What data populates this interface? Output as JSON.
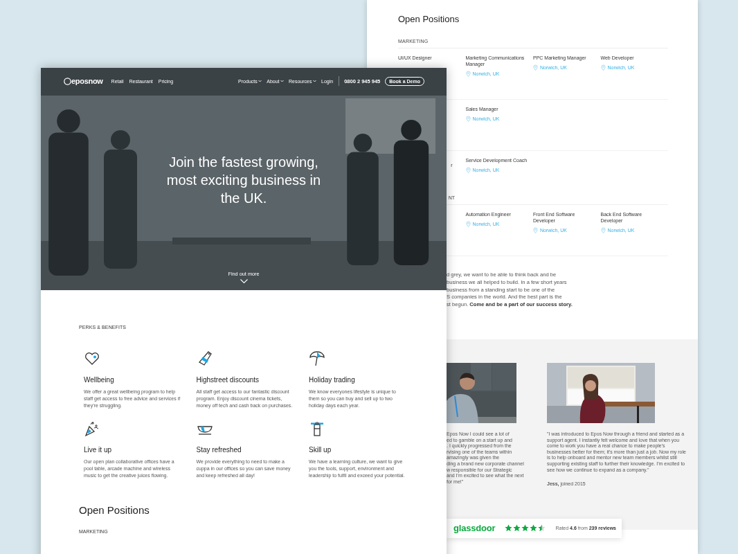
{
  "background_page": {
    "title": "Open Positions",
    "sections": [
      {
        "label": "MARKETING",
        "covered": false,
        "rows": [
          {
            "cells": [
              {
                "kind": "job",
                "title": "UI/UX Designer"
              },
              {
                "kind": "job",
                "title": "Marketing Communications Manager",
                "location": "Norwich, UK"
              },
              {
                "kind": "job",
                "title": "PPC Marketing Manager",
                "location": "Norwich, UK"
              },
              {
                "kind": "job",
                "title": "Web Developer",
                "location": "Norwich, UK"
              }
            ]
          },
          {
            "cells": [
              {
                "kind": "covered"
              },
              {
                "kind": "job",
                "title": "Sales Manager",
                "location": "Norwich, UK"
              }
            ]
          },
          {
            "cells": [
              {
                "kind": "fragment",
                "title": "r"
              },
              {
                "kind": "job",
                "title": "Service Development Coach",
                "location": "Norwich, UK"
              }
            ]
          }
        ]
      },
      {
        "label": "NT",
        "covered": true,
        "rows": [
          {
            "cells": [
              {
                "kind": "covered"
              },
              {
                "kind": "job",
                "title": "Automation Engineer",
                "location": "Norwich, UK"
              },
              {
                "kind": "job",
                "title": "Front End Software Developer",
                "location": "Norwich, UK"
              },
              {
                "kind": "job",
                "title": "Back End Software Developer",
                "location": "Norwich, UK"
              }
            ]
          }
        ]
      }
    ],
    "story": {
      "lines": [
        "d grey, we want to be able to think back and be",
        "business we all helped to build. In a few short years",
        "business from a standing start to be one of the",
        "S companies in the world. And the best part is the",
        "st begun. **Come and be a part of our success story.**"
      ]
    },
    "testimonials": [
      {
        "quote_lines": [
          "Epos Now I could see a lot of",
          "ed to gamble on a start up and",
          ". I quickly progressed from the",
          "rvising one of the teams within",
          "amazingly was given the",
          "ding a brand new corporate channel",
          "w responsible for our Strategic",
          "and I'm excited to see what the next",
          "for me!\""
        ]
      },
      {
        "quote": "\"I was introduced to Epos Now through a friend and started as a support agent. I instantly felt welcome and love that when you come to work you have a real chance to make people's businesses better for them; it's more than just a job. Now my role is to help onboard and mentor new team members whilst still supporting existing staff to further their knowledge. I'm excited to see how we continue to expand as a company.\"",
        "author": "**Jess,** joined 2015"
      }
    ],
    "glassdoor": {
      "logo": "glassdoor",
      "stars": 4.5,
      "rating": "Rated **4.6** from **239 reviews**"
    }
  },
  "front_page": {
    "nav": {
      "logo": "eposnow",
      "links": [
        "Retail",
        "Restaurant",
        "Pricing"
      ],
      "menu": [
        {
          "label": "Products",
          "dropdown": true
        },
        {
          "label": "About",
          "dropdown": true
        },
        {
          "label": "Resources",
          "dropdown": true
        },
        {
          "label": "Login",
          "dropdown": false
        }
      ],
      "phone": "0800 2 945 945",
      "cta": "Book a Demo"
    },
    "hero": {
      "headline": "Join the fastest growing, most exciting business in the UK.",
      "scroll_link": "Find out more"
    },
    "perks": {
      "label": "PERKS & BENEFITS",
      "items": [
        {
          "title": "Wellbeing",
          "text": "We offer a great wellbeing program to help staff get access to free advice and services if they're struggling."
        },
        {
          "title": "Highstreet discounts",
          "text": "All staff get access to our fantastic discount program. Enjoy discount cinema tickets, money off tech and cash back on purchases."
        },
        {
          "title": "Holiday trading",
          "text": "We know everyones lifestyle is unique to them so you can buy and sell up to two holiday days each year."
        },
        {
          "title": "Live it up",
          "text": "Our open plan collaborative offices have a pool table, arcade machine and wireless music to get the creative juices flowing."
        },
        {
          "title": "Stay refreshed",
          "text": "We provide everything to need to make a cuppa in our offices so you can save money and keep refreshed all day!"
        },
        {
          "title": "Skill up",
          "text": "We have a learning culture, we want to give you the tools, support, environment and leadership to fulfil and exceed your potential."
        }
      ]
    },
    "open_positions": {
      "title": "Open Positions",
      "section_label": "MARKETING"
    }
  }
}
